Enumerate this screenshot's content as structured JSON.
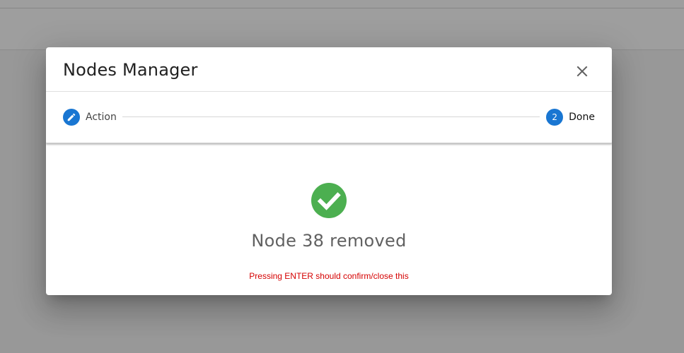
{
  "dialog": {
    "title": "Nodes Manager",
    "close_icon": "close-icon"
  },
  "stepper": {
    "steps": [
      {
        "label": "Action",
        "icon": "pencil-icon",
        "state": "edited"
      },
      {
        "label": "Done",
        "number": "2",
        "state": "active"
      }
    ]
  },
  "content": {
    "status_icon": "check-circle-icon",
    "message": "Node 38 removed",
    "hint": "Pressing ENTER should confirm/close this"
  },
  "colors": {
    "primary": "#1976d2",
    "success": "#4caf50",
    "hint": "#d50000"
  }
}
